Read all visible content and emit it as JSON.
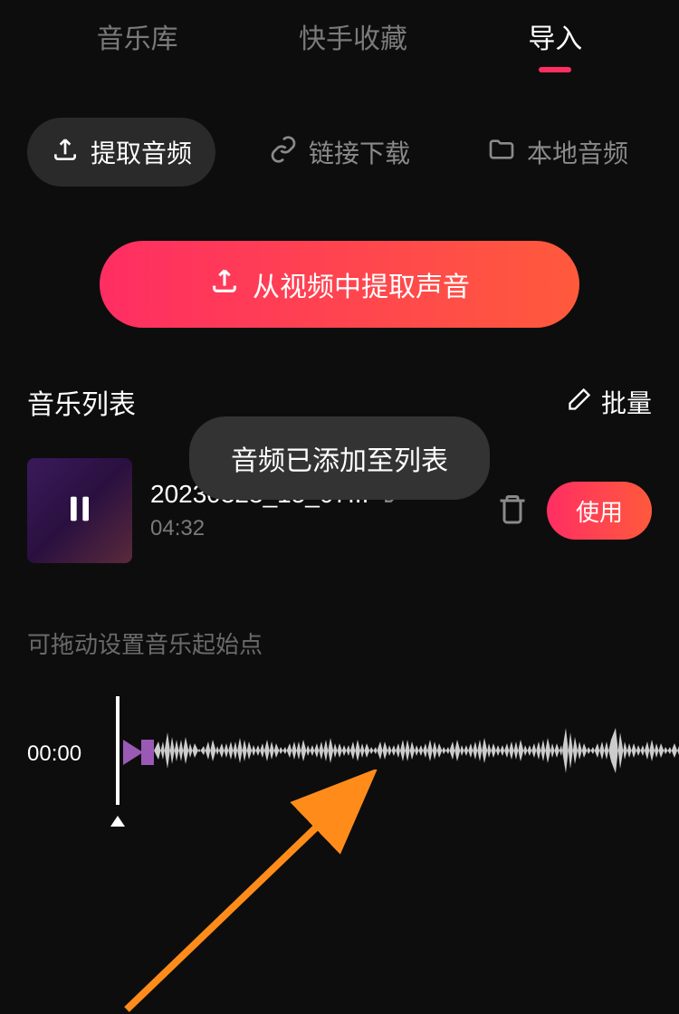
{
  "topTabs": {
    "library": "音乐库",
    "favorites": "快手收藏",
    "import": "导入"
  },
  "subOptions": {
    "extract": "提取音频",
    "link": "链接下载",
    "local": "本地音频"
  },
  "extractButton": "从视频中提取声音",
  "listHeader": {
    "title": "音乐列表",
    "batch": "批量"
  },
  "musicItem": {
    "name": "20230323_15_07...",
    "duration": "04:32",
    "useLabel": "使用"
  },
  "hint": "可拖动设置音乐起始点",
  "timeLabel": "00:00",
  "toast": "音频已添加至列表"
}
